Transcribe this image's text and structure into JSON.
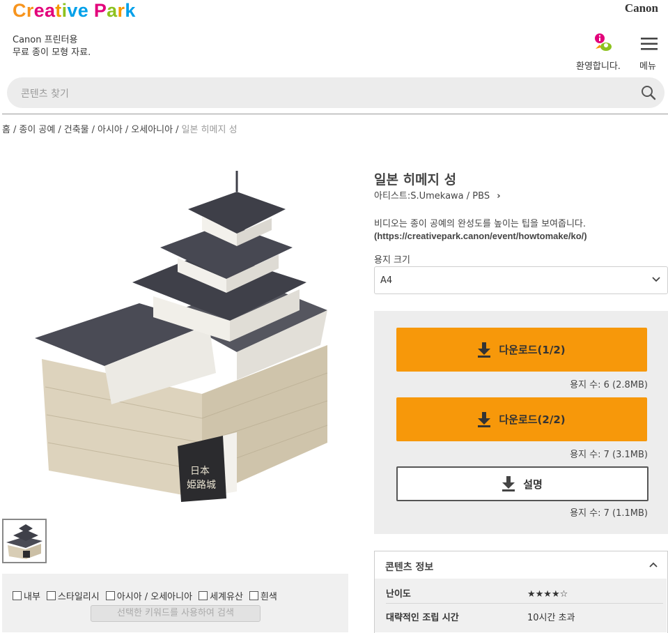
{
  "header": {
    "logo_letters": [
      {
        "ch": "C",
        "color": "#f7941d"
      },
      {
        "ch": "r",
        "color": "#f7941d"
      },
      {
        "ch": "e",
        "color": "#e2007a"
      },
      {
        "ch": "a",
        "color": "#e2007a"
      },
      {
        "ch": "t",
        "color": "#f39800"
      },
      {
        "ch": "i",
        "color": "#8dc21f"
      },
      {
        "ch": "v",
        "color": "#00a0e9"
      },
      {
        "ch": "e",
        "color": "#00a0e9"
      },
      {
        "ch": " ",
        "color": "#000"
      },
      {
        "ch": "P",
        "color": "#e2007a"
      },
      {
        "ch": "a",
        "color": "#8dc21f"
      },
      {
        "ch": "r",
        "color": "#f39800"
      },
      {
        "ch": "k",
        "color": "#00a0e9"
      }
    ],
    "brand": "Canon",
    "tagline_1": "Canon 프린터용",
    "tagline_2": "무료 종이 모형 자료.",
    "welcome_label": "환영합니다.",
    "welcome_icon": "info-person-icon",
    "menu_label": "메뉴",
    "menu_icon": "hamburger-icon"
  },
  "search": {
    "placeholder": "콘텐츠 찾기",
    "icon": "search-icon"
  },
  "breadcrumb": {
    "items": [
      "홈",
      "종이 공예",
      "건축물",
      "아시아",
      "오세아니아"
    ],
    "current": "일본 히메지 성",
    "separator": "/"
  },
  "product": {
    "title": "일본 히메지 성",
    "artist": "아티스트:S.Umekawa / PBS",
    "video_note": "비디오는 종이 공예의 완성도를 높이는 팁을 보여줍니다.",
    "video_link": "(https://creativepark.canon/event/howtomake/ko/)",
    "paper_size_label": "용지 크기",
    "paper_size_value": "A4"
  },
  "downloads": [
    {
      "label": "다운로드(1/2)",
      "info": "용지 수: 6 (2.8MB)"
    },
    {
      "label": "다운로드(2/2)",
      "info": "용지 수: 7 (3.1MB)"
    },
    {
      "label": "설명",
      "info": "용지 수: 7 (1.1MB)"
    }
  ],
  "keywords": {
    "items": [
      "내부",
      "스타일리시",
      "아시아 / 오세아니아",
      "세계유산",
      "흰색"
    ],
    "search_button": "선택한 키워드를 사용하여 검색"
  },
  "content_info": {
    "heading": "콘텐츠 정보",
    "rows": [
      {
        "key": "난이도",
        "value": "★★★★☆"
      },
      {
        "key": "대략적인 조립 시간",
        "value": "10시간 초과"
      }
    ]
  },
  "colors": {
    "accent": "#f7980a",
    "panel": "#ededed"
  }
}
